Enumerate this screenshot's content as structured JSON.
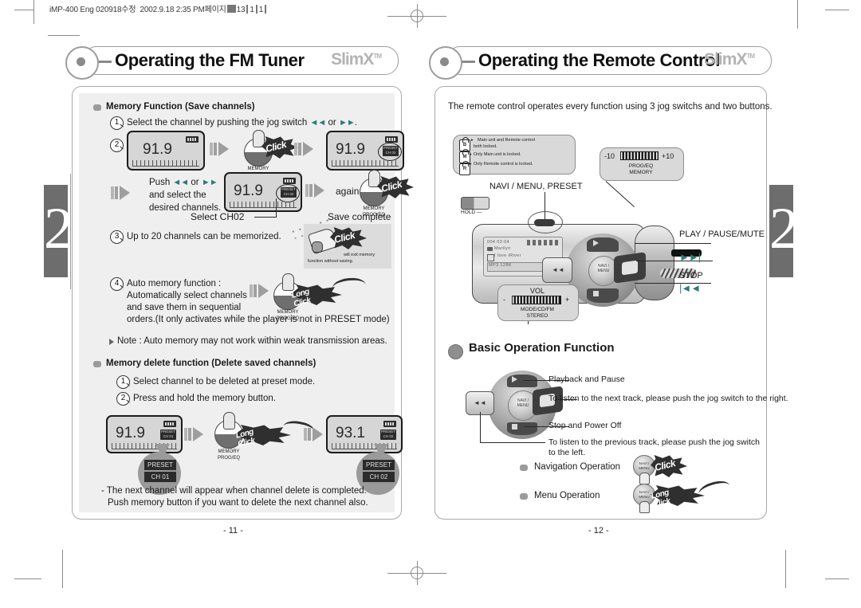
{
  "scan_header": {
    "text_a": "iMP-400 Eng 020918",
    "text_b": "수정",
    "text_c": "2002.9.18 2:35 PM",
    "text_d": "페이지",
    "text_e": "13"
  },
  "chapter_tab": {
    "number": "2"
  },
  "left_page": {
    "title": "Operating the FM Tuner",
    "brand": "SlimX",
    "brand_tm": "TM",
    "page_number": "- 11 -",
    "section_memory": {
      "heading": "Memory Function (Save channels)",
      "step1_no": "1",
      "step1_text_before": "Select the channel by pushing the jog switch",
      "step1_jog_prev": "◄◄",
      "step1_or": "or",
      "step1_jog_next": "►►",
      "step1_text_after": ".",
      "step2_no": "2",
      "lcd1_freq": "91.9",
      "lcd2_freq": "91.9",
      "lcd2_ch_top": "PRESET",
      "lcd2_ch_bot": "CH 02",
      "button_label_top": "MEMORY",
      "button_label_bot": "PROG/EQ",
      "click_label": "Click",
      "push_line1_before": "Push",
      "push_jog_prev": "◄◄",
      "push_or": "or",
      "push_jog_next": "►►",
      "push_line2": "and select the",
      "push_line3": "desired  channels.",
      "lcd3_freq": "91.9",
      "lcd3_ch_top": "PRESET",
      "lcd3_ch_bot": "CH 02",
      "select_ch_label": "Select CH02",
      "again_label": "again",
      "save_complete_label": "Save complete",
      "step3_no": "3",
      "step3_text": "Up to 20 channels can be memorized.",
      "exit_note_line1": "will exit memory",
      "exit_note_line2": "function without saving.",
      "exit_click_label": "Click",
      "step4_no": "4",
      "step4_line1": "Auto memory function :",
      "step4_line2": "Automatically select channels",
      "step4_line3": "and save them in sequential",
      "step4_line4": "orders.(It only activates while the player is not in PRESET mode)",
      "long_click_label": "Long Click",
      "note": "Note : Auto memory may not work within weak transmission areas."
    },
    "section_delete": {
      "heading": "Memory delete function (Delete saved channels)",
      "step1_no": "1",
      "step1_text": "Select channel to be deleted at preset mode.",
      "step2_no": "2",
      "step2_text": "Press and hold the memory button.",
      "lcd_left_freq": "91.9",
      "lcd_left_ch_top": "PRESET",
      "lcd_left_ch_bot": "CH 01",
      "callout_left_top": "PRESET",
      "callout_left_bot": "CH 01",
      "button_label_top": "MEMORY",
      "button_label_bot": "PROG/EQ",
      "long_click_label": "Long Click",
      "lcd_right_freq": "93.1",
      "lcd_right_ch_top": "PRESET",
      "lcd_right_ch_bot": "CH 02",
      "callout_right_top": "PRESET",
      "callout_right_bot": "CH 02",
      "footer_line1": "- The next channel will appear when channel delete is completed.",
      "footer_line2": "Push memory button if you want to delete the next channel also."
    }
  },
  "right_page": {
    "title": "Operating the Remote Control",
    "brand": "SlimX",
    "brand_tm": "TM",
    "page_number": "- 12 -",
    "intro": "The remote control operates every function using 3 jog switchs and two buttons.",
    "lock_callout": {
      "row1_icon": "B",
      "row1_line1": "Main unit and Remote control",
      "row1_line2": "both locked.",
      "row2_icon": "M",
      "row2_line1": "Only Main unit is locked.",
      "row3_icon": "R",
      "row3_line1": "Only Remote control is locked."
    },
    "eq_callout": {
      "min": "-10",
      "max": "+10",
      "line1": "PROG/EQ",
      "line2": "MEMORY"
    },
    "vol_callout": {
      "title": "VOL",
      "minus": "-",
      "plus": "+",
      "line1": "MODE/CD/FM",
      "line2": "STEREO"
    },
    "labels": {
      "navi_menu_preset": "NAVI / MENU, PRESET",
      "hold": "HOLD",
      "play_pause_mute": "PLAY / PAUSE/MUTE",
      "next_glyph": "►►|",
      "stop": "STOP",
      "prev_glyph": "|◄◄"
    },
    "lcd": {
      "line1": "004 02:04",
      "line2": "Marilyn",
      "line3": "I  love  iRiver",
      "line4": "MP3 128K"
    },
    "basic_operation": {
      "heading": "Basic Operation Function",
      "item1": "Playback and Pause",
      "item2": "To listen to the next track, please push the jog switch to the right.",
      "item3": "Stop and Power Off",
      "item4_line1": "To listen to the previous track, please push the jog switch",
      "item4_line2": "to the left.",
      "nav_op_label": "Navigation Operation",
      "nav_op_click": "Click",
      "menu_op_label": "Menu Operation",
      "menu_op_click": "Long Click",
      "pad_label_line1": "NAVI /",
      "pad_label_line2": "MENU"
    }
  },
  "colors": {
    "frame": "#a9a9a9",
    "panel": "#efefef",
    "tab": "#6d6d6d",
    "brand": "#b3b3b3",
    "jog": "#2e7d78",
    "lcd_bg": "#d6d6d6"
  }
}
